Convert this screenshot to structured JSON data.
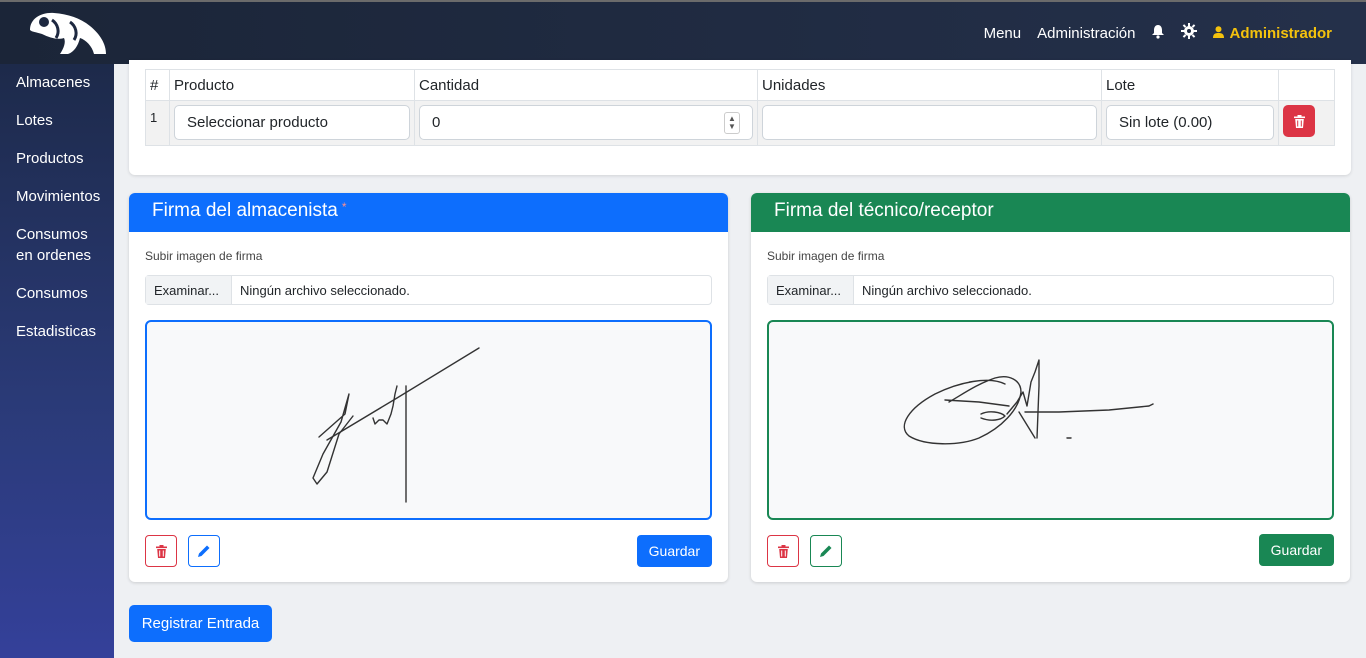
{
  "colors": {
    "primary": "#0d6efd",
    "success": "#198754",
    "danger": "#dc3545",
    "user": "#f4c20d"
  },
  "nav": {
    "menu": "Menu",
    "admin": "Administración",
    "user": "Administrador",
    "icons": [
      "bell-icon",
      "gear-icon",
      "user-icon"
    ]
  },
  "sidebar": {
    "items": [
      {
        "label": "Almacenes"
      },
      {
        "label": "Lotes"
      },
      {
        "label": "Productos"
      },
      {
        "label": "Movimientos"
      },
      {
        "label": "Consumos en ordenes"
      },
      {
        "label": "Consumos"
      },
      {
        "label": "Estadisticas"
      }
    ]
  },
  "table": {
    "headers": [
      "#",
      "Producto",
      "Cantidad",
      "Unidades",
      "Lote",
      ""
    ],
    "row": {
      "num": "1",
      "product": "Seleccionar producto",
      "quantity": "0",
      "units": "",
      "lot": "Sin lote (0.00)"
    }
  },
  "sig_left": {
    "title": "Firma del almacenista",
    "required": "*",
    "upload_label": "Subir imagen de firma",
    "browse": "Examinar...",
    "no_file": "Ningún archivo seleccionado.",
    "save": "Guardar"
  },
  "sig_right": {
    "title": "Firma del técnico/receptor",
    "upload_label": "Subir imagen de firma",
    "browse": "Examinar...",
    "no_file": "Ningún archivo seleccionado.",
    "save": "Guardar"
  },
  "register": "Registrar Entrada"
}
